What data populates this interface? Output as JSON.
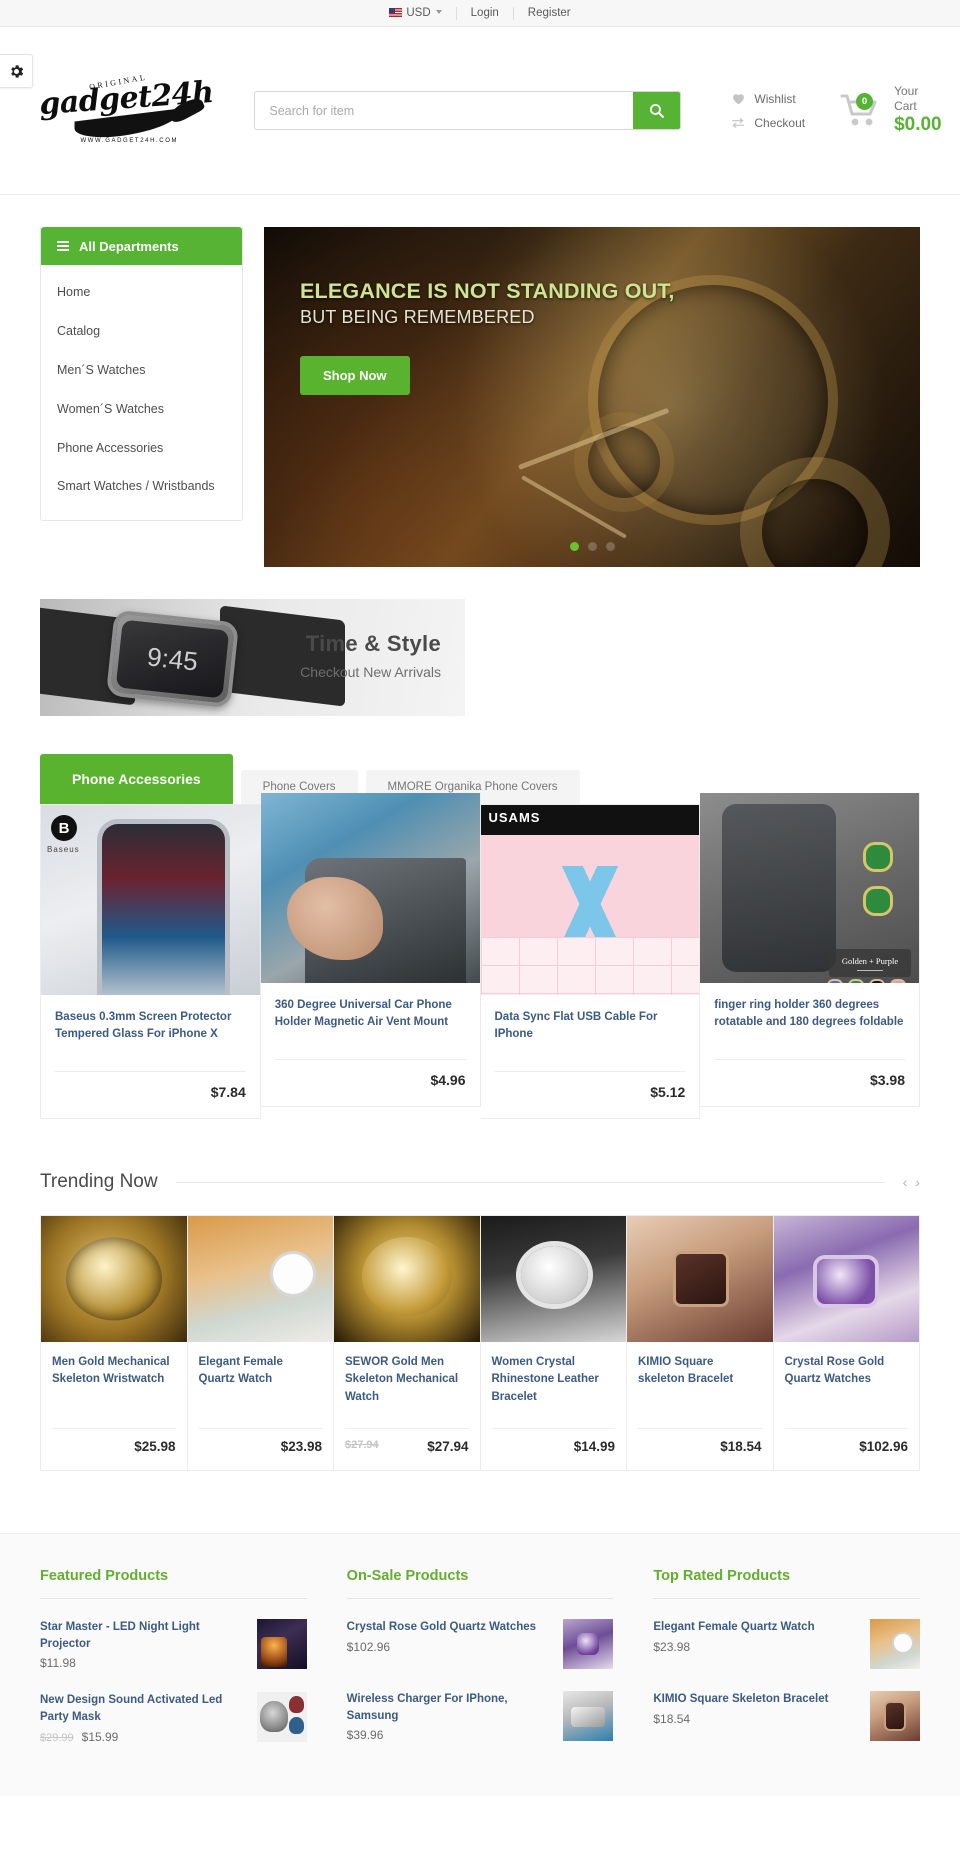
{
  "topbar": {
    "currency": "USD",
    "login": "Login",
    "register": "Register"
  },
  "header": {
    "logo_original": "ORIGINAL",
    "logo_name": "gadget24h",
    "logo_url": "WWW.GADGET24H.COM",
    "search_placeholder": "Search for item",
    "search_value": "",
    "wishlist": "Wishlist",
    "checkout": "Checkout",
    "cart_count": "0",
    "cart_label": "Your Cart",
    "cart_total": "$0.00"
  },
  "departments": {
    "title": "All Departments",
    "items": [
      {
        "label": "Home"
      },
      {
        "label": "Catalog"
      },
      {
        "label": "Men´S Watches"
      },
      {
        "label": "Women´S Watches"
      },
      {
        "label": "Phone Accessories"
      },
      {
        "label": "Smart Watches / Wristbands"
      }
    ]
  },
  "hero": {
    "line1": "ELEGANCE IS NOT STANDING OUT,",
    "line2": "BUT BEING REMEMBERED",
    "button": "Shop Now",
    "dots": 3,
    "active_dot": 0
  },
  "promo": {
    "watch_time": "9:45",
    "title": "Time & Style",
    "subtitle": "Checkout New Arrivals"
  },
  "tab_section": {
    "tabs": [
      {
        "label": "Phone Accessories",
        "active": true
      },
      {
        "label": "Phone Covers",
        "active": false
      },
      {
        "label": "MMORE Organika Phone Covers",
        "active": false
      }
    ],
    "products": [
      {
        "title": "Baseus 0.3mm Screen Protector Tempered Glass For iPhone X",
        "price": "$7.84",
        "old_price": "",
        "brand_badge": "B",
        "brand_text": "Baseus",
        "art": "a-phone1"
      },
      {
        "title": "360 Degree Universal Car Phone Holder Magnetic Air Vent Mount",
        "price": "$4.96",
        "old_price": "",
        "art": "a-car"
      },
      {
        "title": "Data Sync Flat USB Cable For IPhone",
        "price": "$5.12",
        "old_price": "",
        "brand_text": "USAMS",
        "art": "a-usb"
      },
      {
        "title": "finger ring holder 360 degrees rotatable and 180 degrees foldable",
        "price": "$3.98",
        "old_price": "",
        "color_label": "Golden + Purple",
        "art": "a-ring"
      }
    ]
  },
  "trending": {
    "title": "Trending Now",
    "prev_icon": "chevron-left",
    "next_icon": "chevron-right",
    "products": [
      {
        "title": "Men Gold Mechanical Skeleton Wristwatch",
        "price": "$25.98",
        "old_price": "",
        "art": "w-gold"
      },
      {
        "title": "Elegant Female Quartz Watch",
        "price": "$23.98",
        "old_price": "",
        "art": "w-knit"
      },
      {
        "title": "SEWOR Gold Men Skeleton Mechanical Watch",
        "price": "$27.94",
        "old_price": "$27.94",
        "art": "w-skel"
      },
      {
        "title": "Women Crystal Rhinestone Leather Bracelet",
        "price": "$14.99",
        "old_price": "",
        "art": "w-rhine"
      },
      {
        "title": "KIMIO Square skeleton Bracelet",
        "price": "$18.54",
        "old_price": "",
        "art": "w-kimio"
      },
      {
        "title": "Crystal Rose Gold Quartz Watches",
        "price": "$102.96",
        "old_price": "",
        "art": "w-purple"
      }
    ]
  },
  "footer_lists": [
    {
      "title": "Featured Products",
      "items": [
        {
          "name": "Star Master - LED Night Light Projector",
          "price": "$11.98",
          "old_price": "",
          "art": "t-star"
        },
        {
          "name": "New Design Sound Activated Led Party Mask",
          "price": "$15.99",
          "old_price": "$29.99",
          "art": "t-mask"
        }
      ]
    },
    {
      "title": "On-Sale Products",
      "items": [
        {
          "name": "Crystal Rose Gold Quartz Watches",
          "price": "$102.96",
          "old_price": "",
          "art": "t-purple"
        },
        {
          "name": "Wireless Charger For IPhone, Samsung",
          "price": "$39.96",
          "old_price": "",
          "art": "t-wire"
        }
      ]
    },
    {
      "title": "Top Rated Products",
      "items": [
        {
          "name": "Elegant Female Quartz Watch",
          "price": "$23.98",
          "old_price": "",
          "art": "t-knit"
        },
        {
          "name": "KIMIO Square Skeleton Bracelet",
          "price": "$18.54",
          "old_price": "",
          "art": "t-kimio"
        }
      ]
    }
  ],
  "colors": {
    "brand_green": "#57b333",
    "link_blue": "#3c5a82",
    "price_dark": "#2b2b2b"
  }
}
